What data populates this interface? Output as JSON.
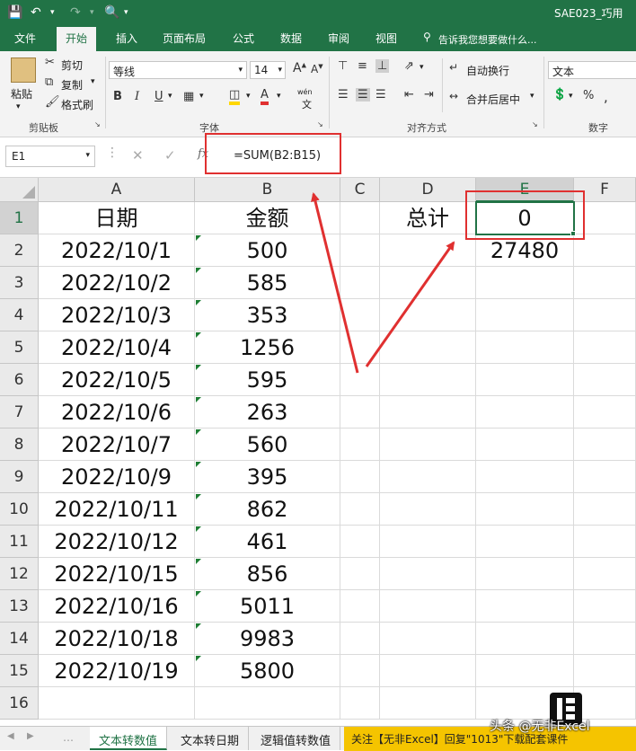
{
  "titlebar": {
    "filename": "SAE023_巧用"
  },
  "tabs": [
    "文件",
    "开始",
    "插入",
    "页面布局",
    "公式",
    "数据",
    "审阅",
    "视图"
  ],
  "tell_me": "告诉我您想要做什么...",
  "ribbon": {
    "paste": "粘贴",
    "cut": "剪切",
    "copy": "复制",
    "format_painter": "格式刷",
    "clipboard_group": "剪贴板",
    "font_name": "等线",
    "font_size": "14",
    "font_group": "字体",
    "bold": "B",
    "italic": "I",
    "underline": "U",
    "wen": "wén",
    "wrap": "自动换行",
    "merge": "合并后居中",
    "align_group": "对齐方式",
    "number_format": "文本",
    "number_group": "数字",
    "percent": "%"
  },
  "formula": {
    "name_box": "E1",
    "content": "=SUM(B2:B15)",
    "fx": "fx"
  },
  "columns": [
    "A",
    "B",
    "C",
    "D",
    "E",
    "F"
  ],
  "rows": [
    {
      "n": "1",
      "a": "日期",
      "b": "金额",
      "d": "总计",
      "e": "0"
    },
    {
      "n": "2",
      "a": "2022/10/1",
      "b": "500",
      "d": "",
      "e": "27480"
    },
    {
      "n": "3",
      "a": "2022/10/2",
      "b": "585",
      "d": "",
      "e": ""
    },
    {
      "n": "4",
      "a": "2022/10/3",
      "b": "353",
      "d": "",
      "e": ""
    },
    {
      "n": "5",
      "a": "2022/10/4",
      "b": "1256",
      "d": "",
      "e": ""
    },
    {
      "n": "6",
      "a": "2022/10/5",
      "b": "595",
      "d": "",
      "e": ""
    },
    {
      "n": "7",
      "a": "2022/10/6",
      "b": "263",
      "d": "",
      "e": ""
    },
    {
      "n": "8",
      "a": "2022/10/7",
      "b": "560",
      "d": "",
      "e": ""
    },
    {
      "n": "9",
      "a": "2022/10/9",
      "b": "395",
      "d": "",
      "e": ""
    },
    {
      "n": "10",
      "a": "2022/10/11",
      "b": "862",
      "d": "",
      "e": ""
    },
    {
      "n": "11",
      "a": "2022/10/12",
      "b": "461",
      "d": "",
      "e": ""
    },
    {
      "n": "12",
      "a": "2022/10/15",
      "b": "856",
      "d": "",
      "e": ""
    },
    {
      "n": "13",
      "a": "2022/10/16",
      "b": "5011",
      "d": "",
      "e": ""
    },
    {
      "n": "14",
      "a": "2022/10/18",
      "b": "9983",
      "d": "",
      "e": ""
    },
    {
      "n": "15",
      "a": "2022/10/19",
      "b": "5800",
      "d": "",
      "e": ""
    },
    {
      "n": "16",
      "a": "",
      "b": "",
      "d": "",
      "e": ""
    }
  ],
  "sheet_tabs": [
    "文本转数值",
    "文本转日期",
    "逻辑值转数值"
  ],
  "banner": "关注【无非Excel】回复\"1013\"下载配套课件",
  "watermark": "头条 @无非Excel",
  "colors": {
    "excel_green": "#217346",
    "annotation_red": "#e03030",
    "banner_bg": "#f5c400"
  }
}
